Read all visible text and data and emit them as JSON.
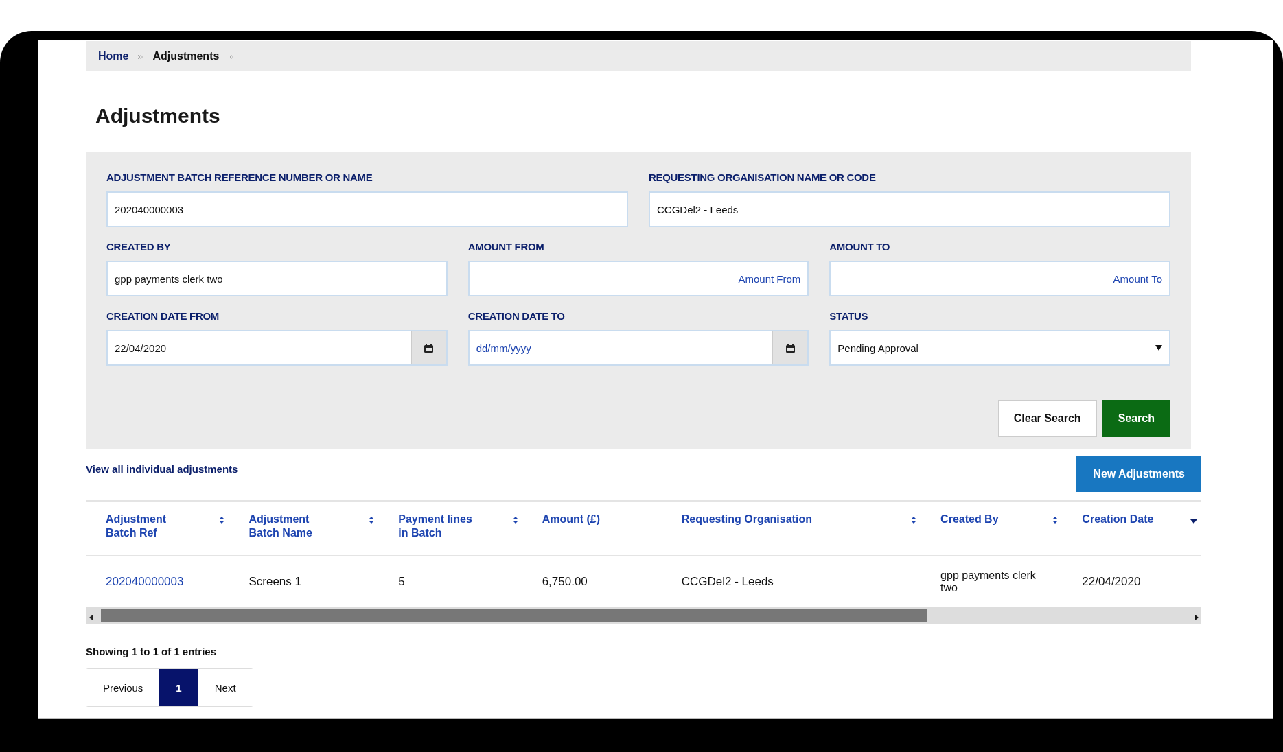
{
  "breadcrumb": [
    {
      "label": "Home",
      "current": false
    },
    {
      "label": "Adjustments",
      "current": true
    }
  ],
  "page_title": "Adjustments",
  "search_form": {
    "fields": [
      {
        "kind": "text",
        "label": "ADJUSTMENT BATCH REFERENCE NUMBER OR NAME",
        "value": "202040000003"
      },
      {
        "kind": "text",
        "label": "REQUESTING ORGANISATION NAME OR CODE",
        "value": "CCGDel2 - Leeds"
      },
      {
        "kind": "text",
        "label": "CREATED BY",
        "value": "gpp payments clerk two"
      },
      {
        "kind": "amount",
        "label": "AMOUNT FROM",
        "placeholder": "Amount From"
      },
      {
        "kind": "amount",
        "label": "AMOUNT TO",
        "placeholder": "Amount To"
      },
      {
        "kind": "date",
        "label": "CREATION DATE FROM",
        "value": "22/04/2020"
      },
      {
        "kind": "date",
        "label": "CREATION DATE TO",
        "placeholder": "dd/mm/yyyy"
      },
      {
        "kind": "select",
        "label": "STATUS",
        "value": "Pending Approval"
      }
    ],
    "buttons": [
      {
        "label": "Clear Search",
        "kind": "secondary"
      },
      {
        "label": "Search",
        "kind": "primary"
      }
    ]
  },
  "view_all_link": "View all individual adjustments",
  "new_button": "New Adjustments",
  "table": {
    "columns": [
      {
        "label": "Adjustment Batch Ref",
        "sortable": true,
        "sorted": false
      },
      {
        "label": "Adjustment Batch Name",
        "sortable": true,
        "sorted": false
      },
      {
        "label": "Payment lines in Batch",
        "sortable": true,
        "sorted": false
      },
      {
        "label": "Amount (£)",
        "sortable": false,
        "sorted": false
      },
      {
        "label": "Requesting Organisation",
        "sortable": true,
        "sorted": false
      },
      {
        "label": "Created By",
        "sortable": true,
        "sorted": false
      },
      {
        "label": "Creation Date",
        "sortable": true,
        "sorted": true
      }
    ],
    "rows": [
      [
        "202040000003",
        "Screens 1",
        "5",
        "6,750.00",
        "CCGDel2 - Leeds",
        "gpp payments clerk two",
        "22/04/2020"
      ]
    ]
  },
  "entries_info": "Showing 1 to 1 of 1 entries",
  "pagination": [
    {
      "label": "Previous",
      "selected": false
    },
    {
      "label": "1",
      "selected": true
    },
    {
      "label": "Next",
      "selected": false
    }
  ]
}
